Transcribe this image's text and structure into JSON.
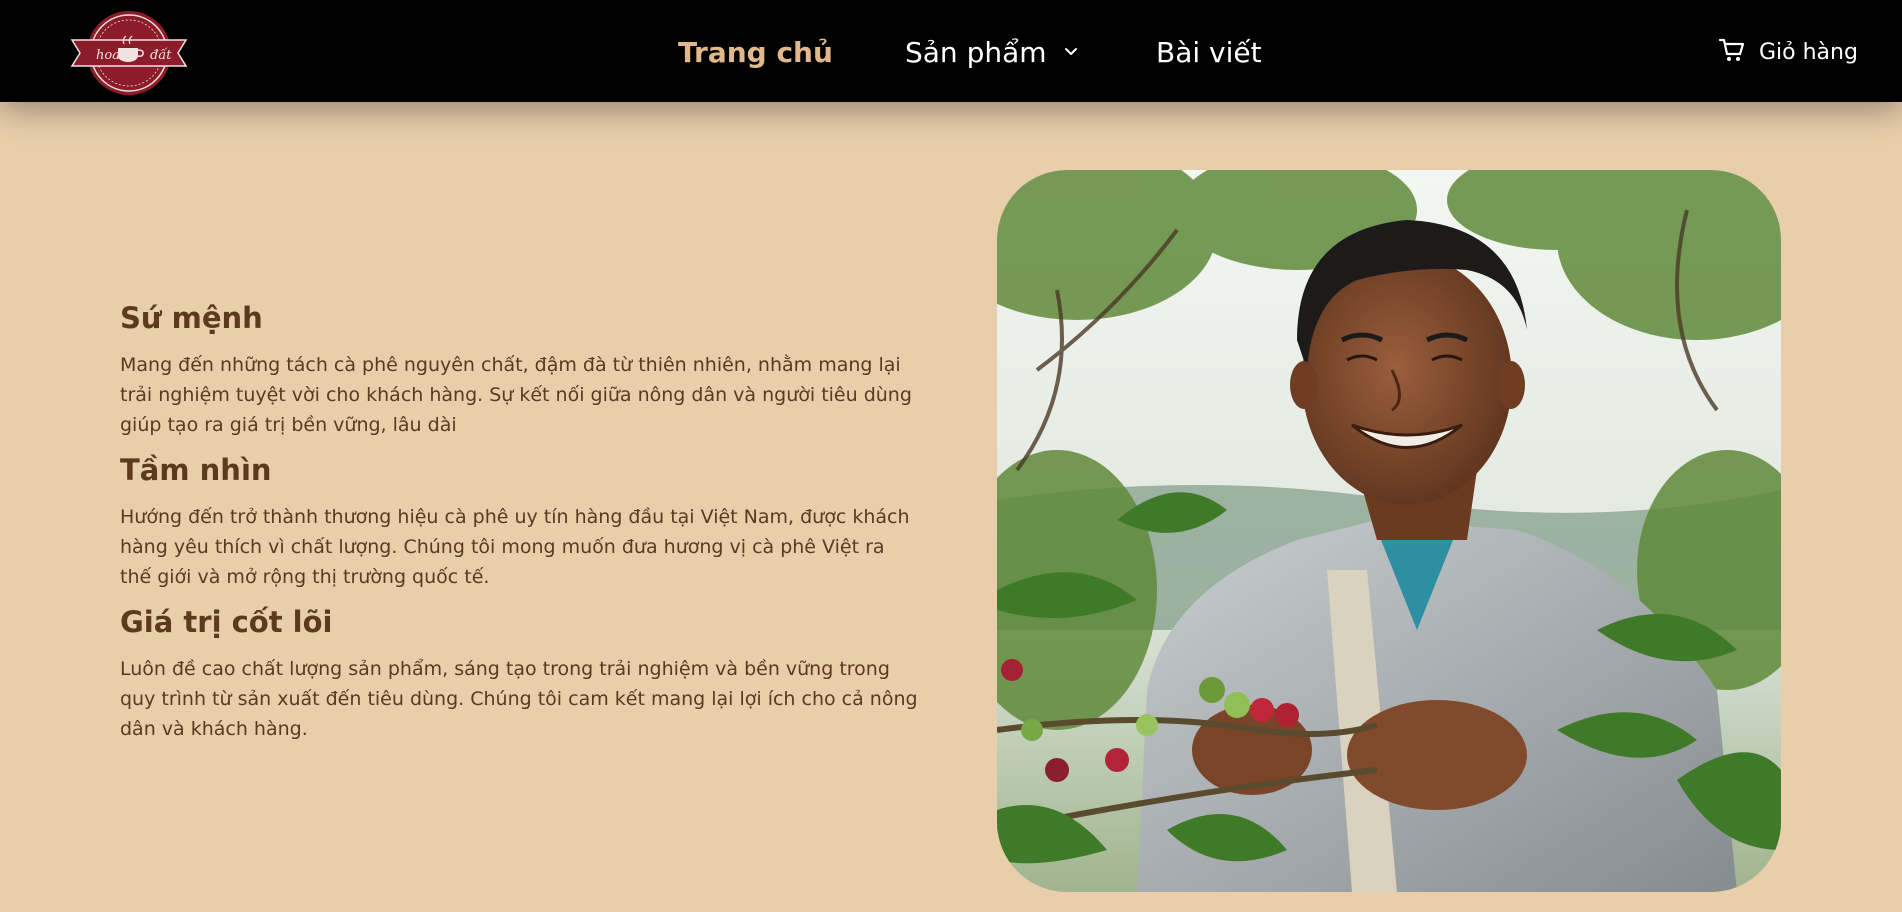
{
  "nav": {
    "items": [
      {
        "label": "Trang chủ",
        "active": true
      },
      {
        "label": "Sản phẩm",
        "has_dropdown": true
      },
      {
        "label": "Bài viết"
      }
    ],
    "cart_label": "Giỏ hàng"
  },
  "logo": {
    "text_left": "hoa",
    "text_right": "đất"
  },
  "sections": [
    {
      "title": "Sứ mệnh",
      "text": "Mang đến những tách cà phê nguyên chất, đậm đà từ thiên nhiên, nhằm mang lại trải nghiệm tuyệt vời cho khách hàng. Sự kết nối giữa nông dân và người tiêu dùng giúp tạo ra giá trị bền vững, lâu dài"
    },
    {
      "title": "Tầm nhìn",
      "text": "Hướng đến trở thành thương hiệu cà phê uy tín hàng đầu tại Việt Nam, được khách hàng yêu thích vì chất lượng. Chúng tôi mong muốn đưa hương vị cà phê Việt ra thế giới và mở rộng thị trường quốc tế."
    },
    {
      "title": "Giá trị cốt lõi",
      "text": "Luôn đề cao chất lượng sản phẩm, sáng tạo trong trải nghiệm và bền vững trong quy trình từ sản xuất đến tiêu dùng. Chúng tôi cam kết mang lại lợi ích cho cả nông dân và khách hàng."
    }
  ],
  "colors": {
    "nav_bg": "#000000",
    "active_nav": "#e2b88b",
    "page_bg": "#e8ceaa",
    "text_brown": "#5b3a1e"
  }
}
